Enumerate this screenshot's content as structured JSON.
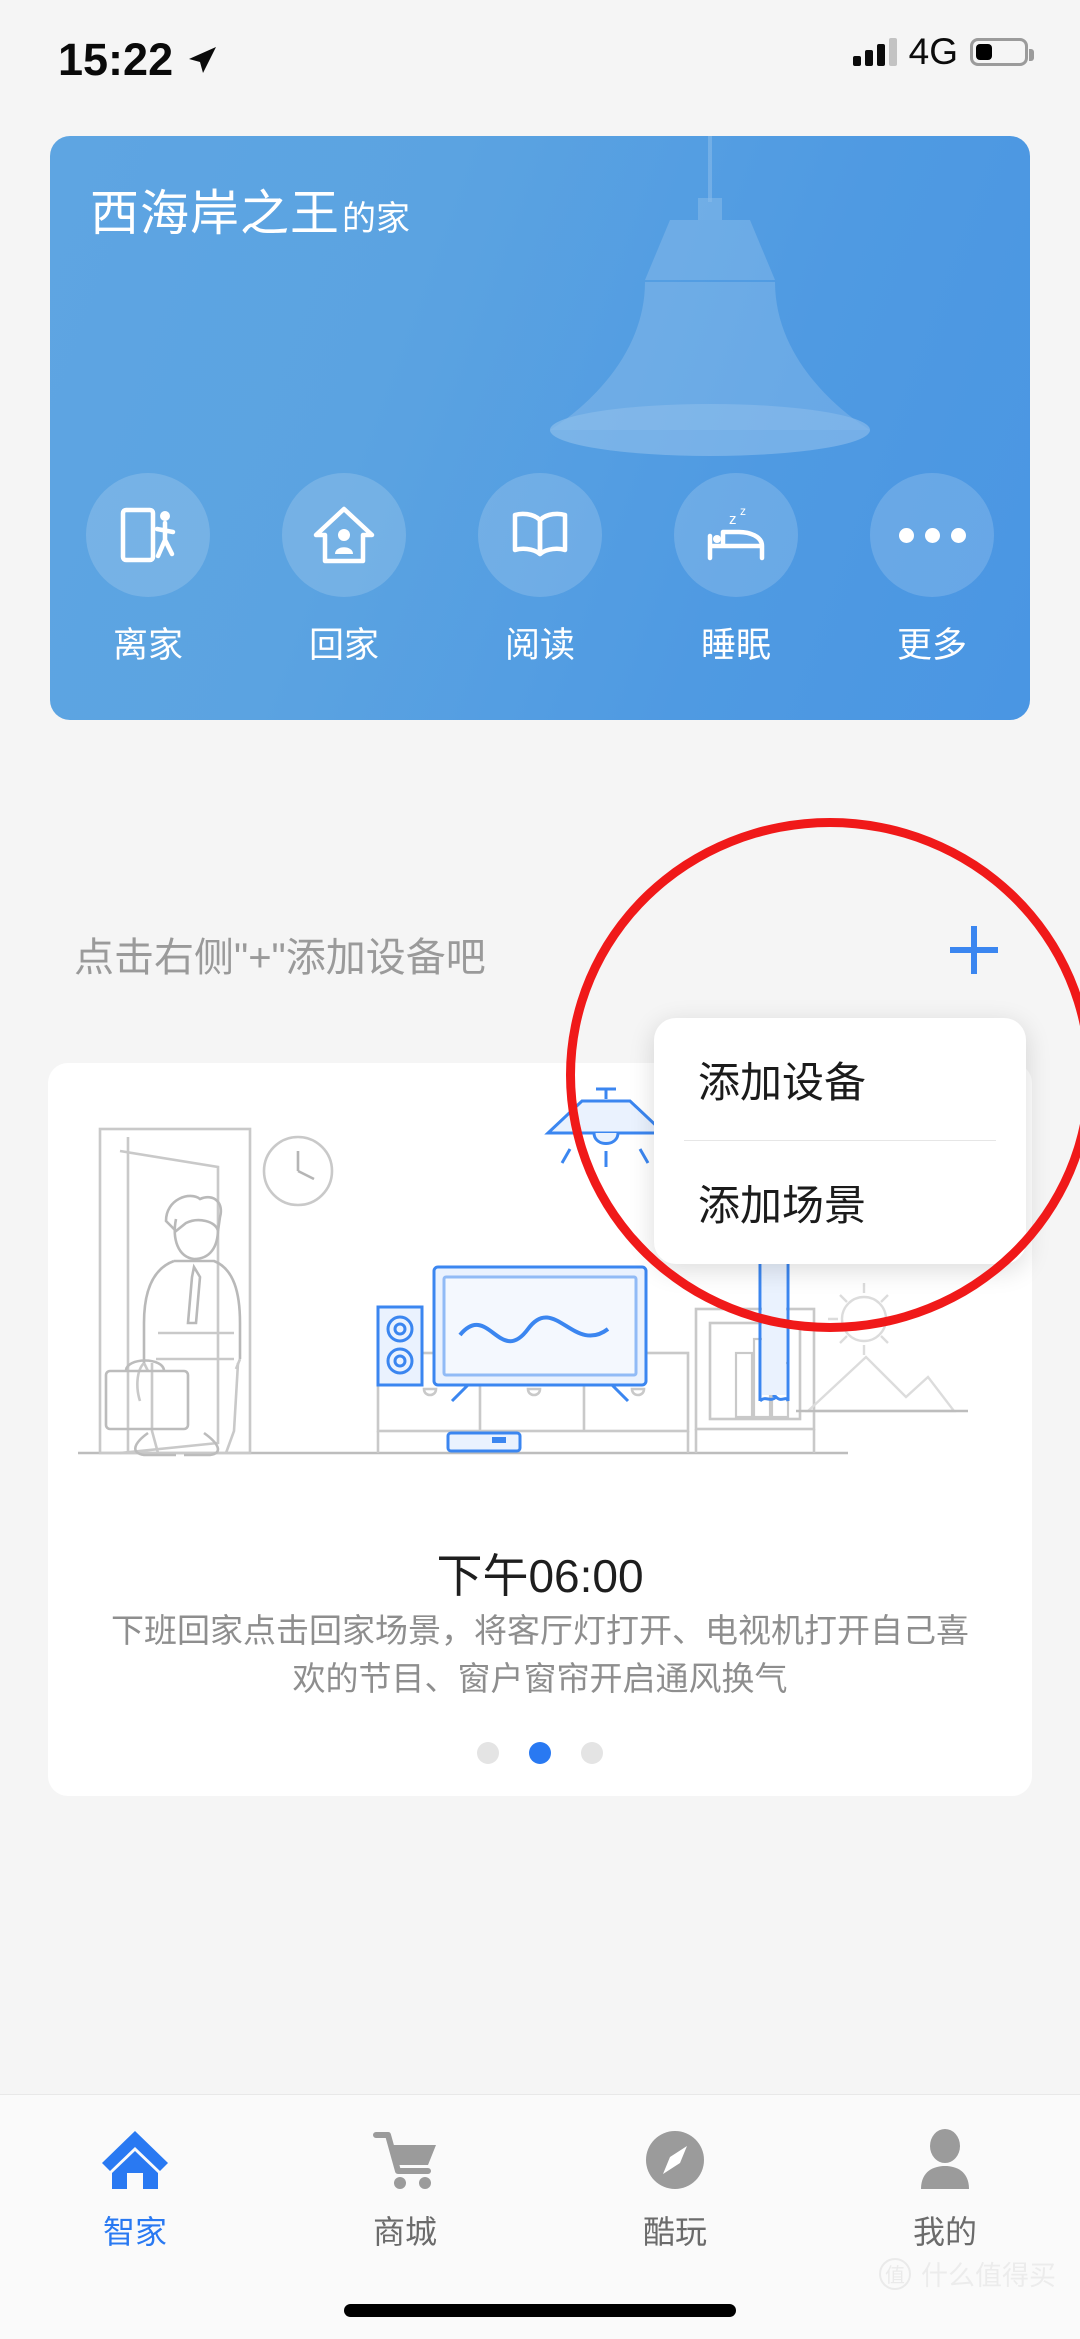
{
  "status_bar": {
    "time": "15:22",
    "location_icon": "location-arrow-icon",
    "signal_icon": "signal-bars-icon",
    "network": "4G",
    "battery_icon": "battery-icon",
    "battery_level_pct": 30
  },
  "header": {
    "home_name": "西海岸之王",
    "home_suffix": "的家",
    "background_color": "#5ba3e1",
    "lamp_image": "pendant-lamp-photo",
    "scenes": [
      {
        "label": "离家",
        "icon": "door-exit-icon"
      },
      {
        "label": "回家",
        "icon": "house-person-icon"
      },
      {
        "label": "阅读",
        "icon": "open-book-icon"
      },
      {
        "label": "睡眠",
        "icon": "bed-sleep-icon"
      },
      {
        "label": "更多",
        "icon": "ellipsis-icon"
      }
    ]
  },
  "add_row": {
    "prompt": "点击右侧\"+\"添加设备吧",
    "plus_icon": "plus-icon",
    "plus_color": "#3b86f0"
  },
  "popup_menu": {
    "items": [
      {
        "label": "添加设备"
      },
      {
        "label": "添加场景"
      }
    ]
  },
  "scene_card": {
    "illustration": "living-room-line-art",
    "time_label": "下午06:00",
    "description": "下班回家点击回家场景，将客厅灯打开、电视机打开自己喜欢的节目、窗户窗帘开启通风换气",
    "pager": {
      "total": 3,
      "active_index": 1,
      "active_color": "#2979f2"
    }
  },
  "annotation": {
    "shape": "red-circle-highlight",
    "color": "#f01919"
  },
  "tab_bar": {
    "active_index": 0,
    "active_color": "#2979f2",
    "items": [
      {
        "label": "智家",
        "icon": "home-icon"
      },
      {
        "label": "商城",
        "icon": "shopping-cart-icon"
      },
      {
        "label": "酷玩",
        "icon": "compass-icon"
      },
      {
        "label": "我的",
        "icon": "person-icon"
      }
    ]
  },
  "watermark": {
    "badge": "值",
    "text": "什么值得买"
  }
}
